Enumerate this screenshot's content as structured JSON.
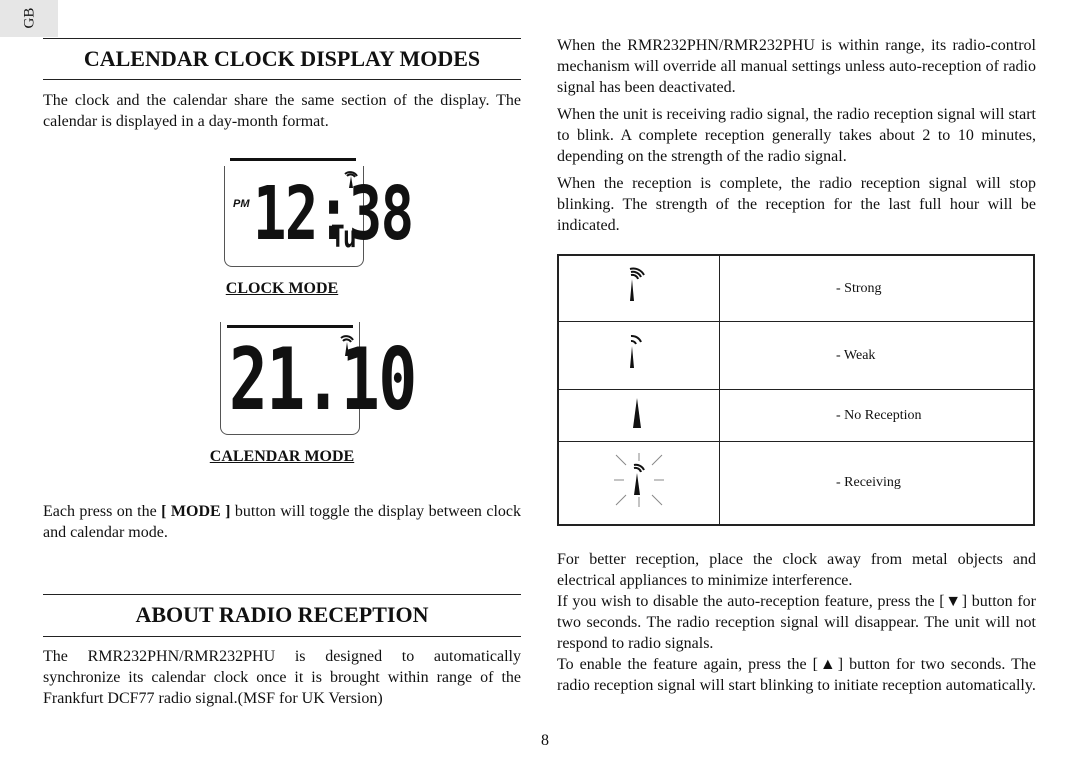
{
  "tab": {
    "label": "GB"
  },
  "left": {
    "heading1": "CALENDAR CLOCK DISPLAY MODES",
    "intro": "The clock and the calendar share the same section of the display. The calendar is displayed in a day-month format.",
    "clock_display": {
      "indicator": "PM",
      "time": "12:38",
      "day": "Tu"
    },
    "clock_caption": "CLOCK MODE",
    "calendar_display": {
      "date": "21.10"
    },
    "calendar_caption": "CALENDAR MODE",
    "mode_text_pre": "Each press on the ",
    "mode_button": "[ MODE ]",
    "mode_text_post": " button will toggle the display between clock and calendar mode.",
    "heading2": "ABOUT RADIO RECEPTION",
    "radio_intro": "The RMR232PHN/RMR232PHU is designed to automatically synchronize its calendar clock once it is brought within range of the Frankfurt DCF77 radio signal.(MSF for UK Version)"
  },
  "right": {
    "p1": "When the RMR232PHN/RMR232PHU is within range, its radio-control mechanism will override all manual settings unless auto-reception of radio signal has been deactivated.",
    "p2": "When the unit is receiving radio signal, the radio reception signal will start to blink. A complete reception generally takes about 2 to 10 minutes, depending on the strength of the radio signal.",
    "p3": "When the reception is complete, the radio reception signal will stop blinking. The strength of the reception for the last full hour will be indicated.",
    "signal_table": [
      {
        "icon": "signal-strong-icon",
        "label": "-   Strong"
      },
      {
        "icon": "signal-weak-icon",
        "label": "-   Weak"
      },
      {
        "icon": "signal-none-icon",
        "label": "-   No Reception"
      },
      {
        "icon": "signal-receiving-icon",
        "label": "-   Receiving"
      }
    ],
    "p4": "For better reception, place the clock away from metal objects and electrical appliances to minimize interference.",
    "p5": "If you wish to disable the auto-reception feature, press the [▼] button for two seconds. The radio reception signal will disappear. The unit will not respond to radio signals.",
    "p6": "To enable the feature again, press the [▲] button for two seconds. The radio reception signal will start blinking to initiate reception automatically."
  },
  "page_number": "8"
}
